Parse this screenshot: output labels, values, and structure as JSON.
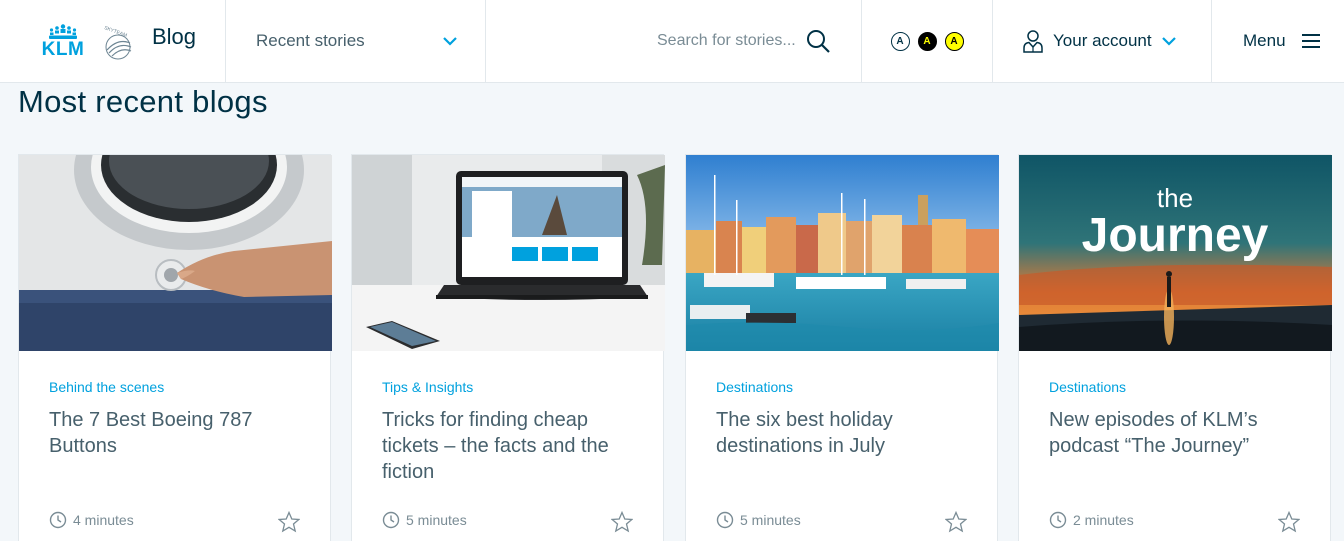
{
  "header": {
    "logo_text": "KLM",
    "skyteam_text": "SKYTEAM",
    "blog_label": "Blog",
    "dropdown_label": "Recent stories",
    "search_placeholder": "Search for stories...",
    "a11y_labels": [
      "A",
      "A",
      "A"
    ],
    "account_label": "Your account",
    "menu_label": "Menu"
  },
  "page_title": "Most recent blogs",
  "cards": [
    {
      "category": "Behind the scenes",
      "title": "The 7 Best Boeing 787 Buttons",
      "read_time": "4 minutes"
    },
    {
      "category": "Tips & Insights",
      "title": "Tricks for finding cheap tickets – the facts and the fiction",
      "read_time": "5 minutes"
    },
    {
      "category": "Destinations",
      "title": "The six best holiday destinations in July",
      "read_time": "5 minutes"
    },
    {
      "category": "Destinations",
      "title": "New episodes of KLM’s podcast “The Journey”",
      "read_time": "2 minutes"
    }
  ],
  "podcast_art": {
    "word_small": "the",
    "word_large": "Journey"
  },
  "colors": {
    "brand_blue": "#00a1de",
    "dark_navy": "#003145",
    "text_grey": "#47606c",
    "page_bg": "#f3f7fa"
  }
}
